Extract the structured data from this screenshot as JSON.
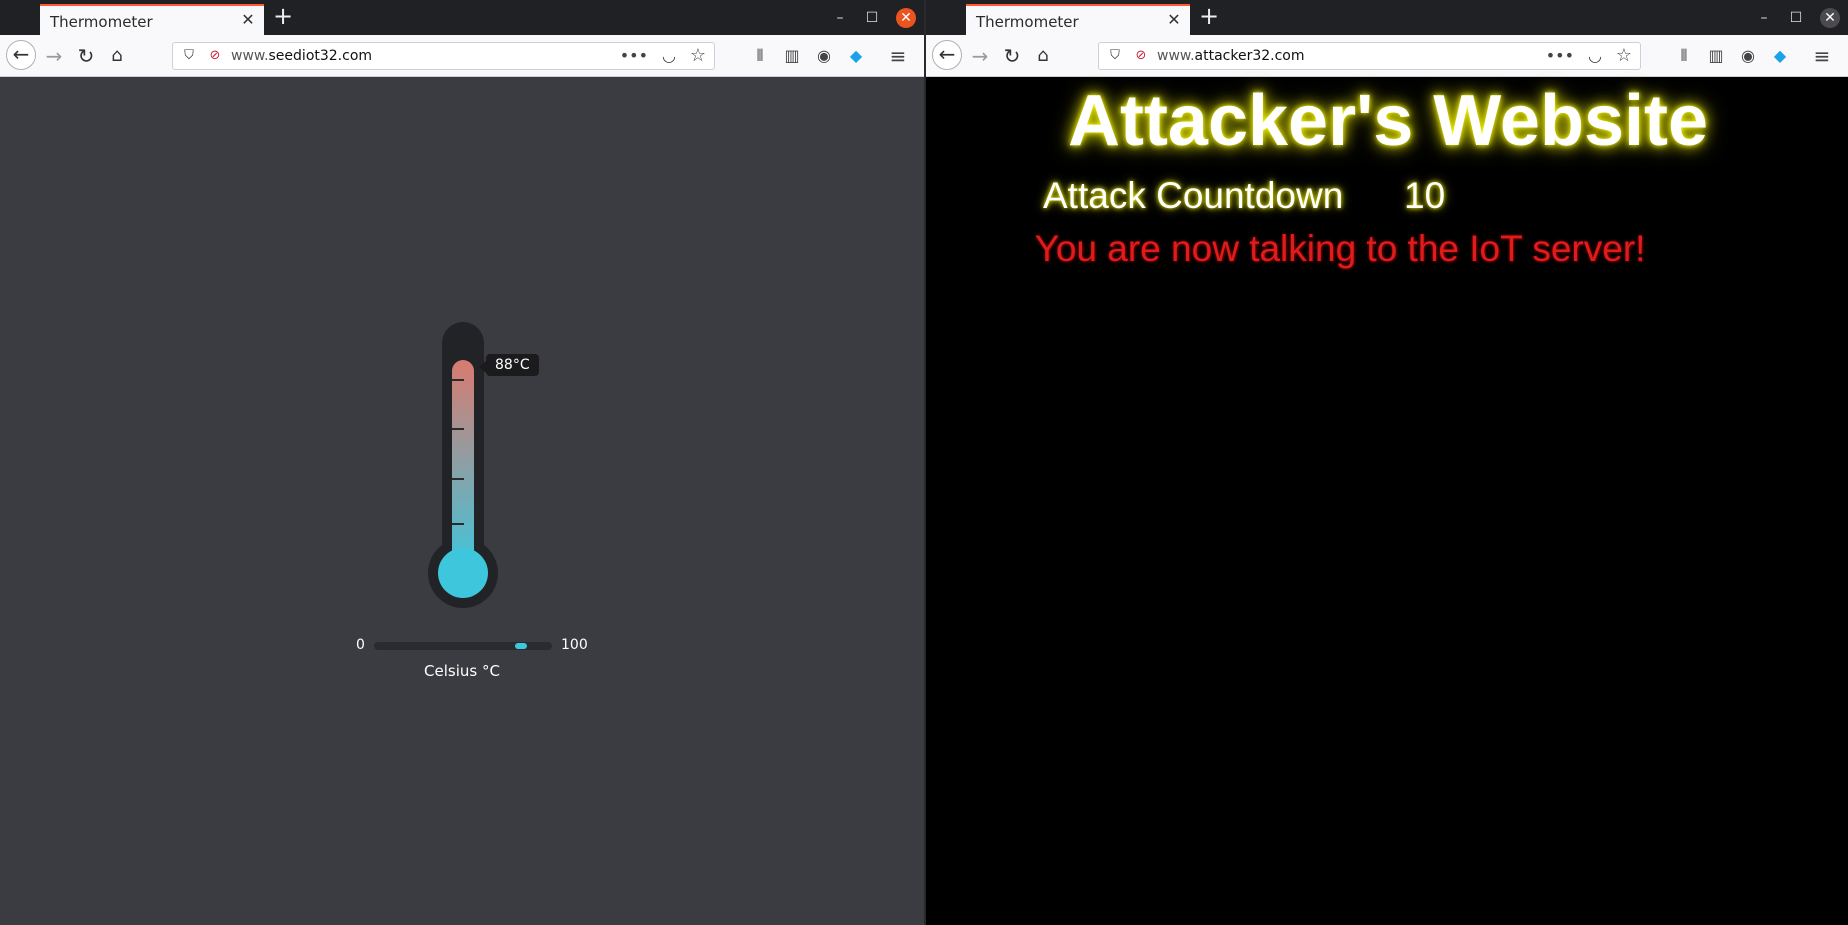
{
  "left_window": {
    "tab_title": "Thermometer",
    "url_prefix": "www.",
    "url_domain": "seediot32.com",
    "page": {
      "temperature_label": "88°C",
      "temperature_value": 88,
      "scale_min": "0",
      "scale_max": "100",
      "unit_label": "Celsius °C",
      "colors": {
        "mercury_hot": "#d97a6f",
        "mercury_cold": "#3ec6dc",
        "slider_thumb": "#3ec6dc"
      }
    }
  },
  "right_window": {
    "tab_title": "Thermometer",
    "url_prefix": "www.",
    "url_domain": "attacker32.com",
    "page": {
      "title": "Attacker's Website",
      "countdown_label": "Attack Countdown",
      "countdown_value": "10",
      "message": "You are now talking to the IoT server!"
    }
  },
  "icons": {
    "close_tab": "close-icon",
    "new_tab": "plus-icon",
    "minimize": "minimize-icon",
    "maximize": "maximize-icon",
    "close_window": "close-window-icon",
    "back": "arrow-left-icon",
    "forward": "arrow-right-icon",
    "reload": "reload-icon",
    "home": "home-icon"
  }
}
